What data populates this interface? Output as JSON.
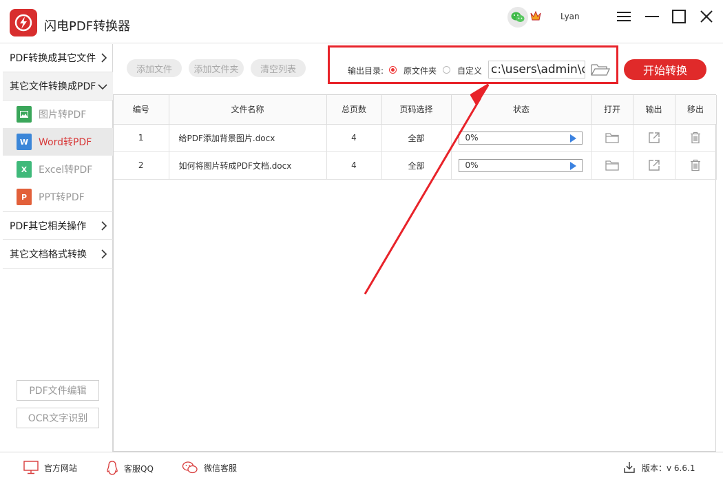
{
  "app": {
    "title": "闪电PDF转换器"
  },
  "user": {
    "name": "Lyan"
  },
  "sidebar": {
    "categories": [
      {
        "label": "PDF转换成其它文件"
      },
      {
        "label": "其它文件转换成PDF"
      },
      {
        "label": "PDF其它相关操作"
      },
      {
        "label": "其它文档格式转换"
      }
    ],
    "sub_items": [
      {
        "label": "图片转PDF",
        "icon": "image-file-icon",
        "color": "#3aa65a"
      },
      {
        "label": "Word转PDF",
        "icon": "word-file-icon",
        "color": "#3b86d8"
      },
      {
        "label": "Excel转PDF",
        "icon": "excel-file-icon",
        "color": "#3fb97a"
      },
      {
        "label": "PPT转PDF",
        "icon": "ppt-file-icon",
        "color": "#e2603a"
      }
    ],
    "buttons": [
      {
        "label": "PDF文件编辑"
      },
      {
        "label": "OCR文字识别"
      }
    ]
  },
  "toolbar": {
    "add_file": "添加文件",
    "add_folder": "添加文件夹",
    "clear_list": "清空列表",
    "output_label": "输出目录:",
    "option_original": "原文件夹",
    "option_custom": "自定义",
    "path_value": "c:\\users\\admin\\d",
    "start": "开始转换"
  },
  "table": {
    "headers": [
      "编号",
      "文件名称",
      "总页数",
      "页码选择",
      "状态",
      "打开",
      "输出",
      "移出"
    ],
    "rows": [
      {
        "index": "1",
        "name": "给PDF添加背景图片.docx",
        "pages": "4",
        "range": "全部",
        "progress_text": "0%",
        "progress": 0
      },
      {
        "index": "2",
        "name": "如何将图片转成PDF文档.docx",
        "pages": "4",
        "range": "全部",
        "progress_text": "0%",
        "progress": 0
      }
    ]
  },
  "footer": {
    "website": "官方网站",
    "qq": "客服QQ",
    "wechat": "微信客服",
    "version_label": "版本：v 6.6.1"
  },
  "colors": {
    "accent": "#e02a2a",
    "highlight": "#e8232a",
    "progress_play": "#3b82e0"
  }
}
